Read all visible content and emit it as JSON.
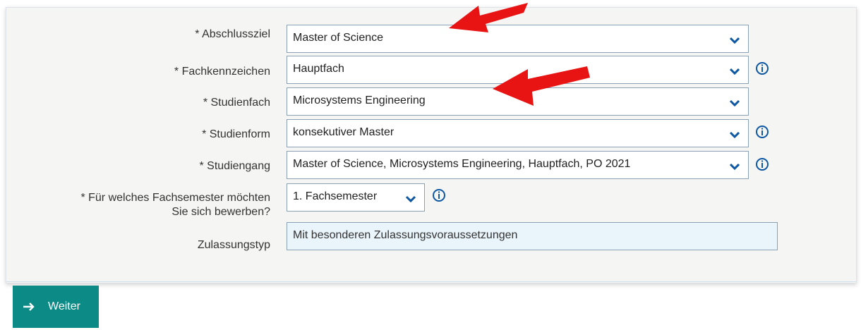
{
  "fields": {
    "abschlussziel": {
      "label": "* Abschlussziel",
      "value": "Master of Science"
    },
    "fachkennzeichen": {
      "label": "* Fachkennzeichen",
      "value": "Hauptfach"
    },
    "studienfach": {
      "label": "* Studienfach",
      "value": "Microsystems Engineering"
    },
    "studienform": {
      "label": "* Studienform",
      "value": "konsekutiver Master"
    },
    "studiengang": {
      "label": "* Studiengang",
      "value": "Master of Science, Microsystems Engineering, Hauptfach, PO 2021"
    },
    "fachsemester": {
      "label_line1": "* Für welches Fachsemester möchten",
      "label_line2": "Sie sich bewerben?",
      "value": "1. Fachsemester"
    },
    "zulassungstyp": {
      "label": "Zulassungstyp",
      "value": "Mit besonderen Zulassungsvoraussetzungen"
    }
  },
  "buttons": {
    "next_label": "Weiter"
  },
  "colors": {
    "accent": "#0b8a86",
    "chevron": "#0d57a3",
    "info": "#0d57a3",
    "annotation_arrow": "#e81313",
    "readonly_bg": "#e9f4fb"
  },
  "icons": {
    "dropdown": "chevron-down-icon",
    "info": "info-circle-icon",
    "next": "arrow-right-icon"
  }
}
